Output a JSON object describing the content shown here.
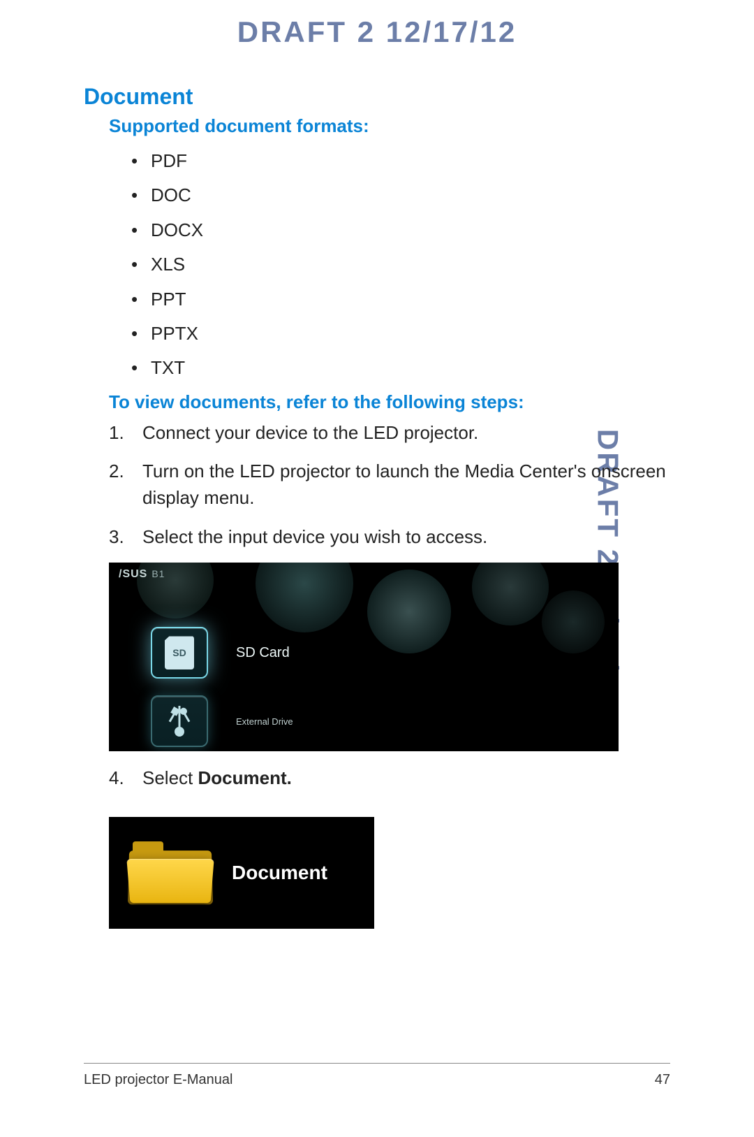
{
  "watermark": "DRAFT 2   12/17/12",
  "headings": {
    "document": "Document",
    "supported": "Supported document formats:",
    "toview": "To view documents, refer to the following steps:"
  },
  "formats": [
    "PDF",
    "DOC",
    "DOCX",
    "XLS",
    "PPT",
    "PPTX",
    "TXT"
  ],
  "steps": {
    "s1": "Connect your device to the LED projector.",
    "s2": "Turn on the LED projector to launch the Media Center's onscreen display menu.",
    "s3": "Select the input device you wish to access.",
    "s4_prefix": "Select ",
    "s4_bold": "Document."
  },
  "media_center": {
    "brand": "/SUS",
    "model": "B1",
    "sd_tile_text": "SD",
    "item1_label": "SD Card",
    "item2_label": "External Drive"
  },
  "doc_tile": {
    "label": "Document"
  },
  "footer": {
    "left": "LED projector E-Manual",
    "right": "47"
  }
}
